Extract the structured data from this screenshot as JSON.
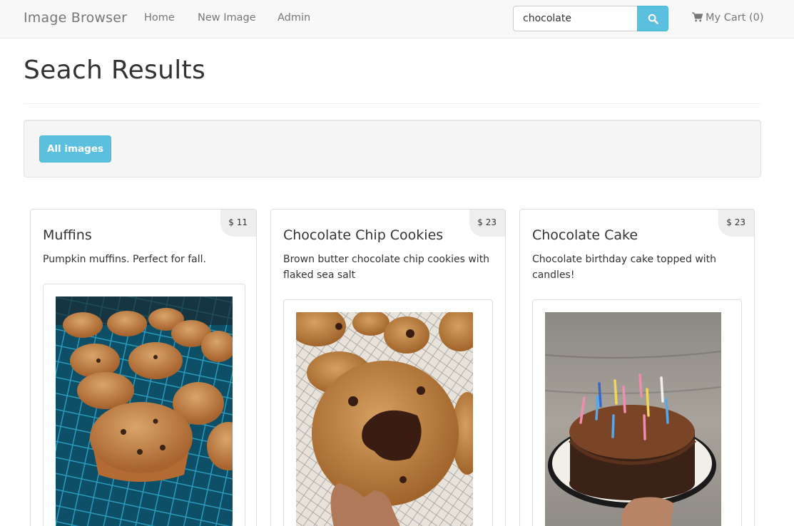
{
  "navbar": {
    "brand": "Image Browser",
    "links": [
      "Home",
      "New Image",
      "Admin"
    ],
    "search_value": "chocolate",
    "cart_label": "My Cart (0)"
  },
  "page": {
    "title": "Seach Results",
    "all_images_button": "All images"
  },
  "products": [
    {
      "title": "Muffins",
      "price": "$ 11",
      "description": "Pumpkin muffins. Perfect for fall."
    },
    {
      "title": "Chocolate Chip Cookies",
      "price": "$ 23",
      "description": "Brown butter chocolate chip cookies with flaked sea salt"
    },
    {
      "title": "Chocolate Cake",
      "price": "$ 23",
      "description": "Chocolate birthday cake topped with candles!"
    }
  ],
  "colors": {
    "accent": "#5bc0de",
    "navbar_bg": "#f8f8f8"
  },
  "icons": {
    "search": "search-icon",
    "cart": "shopping-cart-icon"
  }
}
